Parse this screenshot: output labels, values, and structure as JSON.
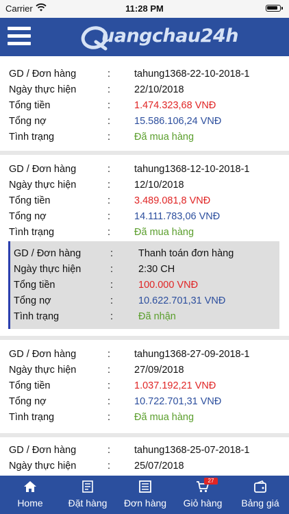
{
  "status_bar": {
    "carrier": "Carrier",
    "time": "11:28 PM"
  },
  "header": {
    "logo_text": "uangchau24h",
    "logo_full": "Quangchau24h"
  },
  "labels": {
    "order": "GD / Đơn hàng",
    "date": "Ngày thực hiện",
    "total": "Tổng tiền",
    "debt": "Tổng nợ",
    "status": "Tình trạng",
    "colon": ":"
  },
  "orders": [
    {
      "order": "tahung1368-22-10-2018-1",
      "date": "22/10/2018",
      "total": "1.474.323,68 VNĐ",
      "debt": "15.586.106,24 VNĐ",
      "status": "Đã mua hàng"
    },
    {
      "order": "tahung1368-12-10-2018-1",
      "date": "12/10/2018",
      "total": "3.489.081,8 VNĐ",
      "debt": "14.111.783,06 VNĐ",
      "status": "Đã mua hàng",
      "payment": {
        "order": "Thanh toán đơn hàng",
        "date": "2:30 CH",
        "total": "100.000 VNĐ",
        "debt": "10.622.701,31 VNĐ",
        "status": "Đã nhận"
      }
    },
    {
      "order": "tahung1368-27-09-2018-1",
      "date": "27/09/2018",
      "total": "1.037.192,21 VNĐ",
      "debt": "10.722.701,31 VNĐ",
      "status": "Đã mua hàng"
    },
    {
      "order": "tahung1368-25-07-2018-1",
      "date": "25/07/2018"
    }
  ],
  "bottom_nav": [
    {
      "label": "Home",
      "icon": "home-icon"
    },
    {
      "label": "Đặt hàng",
      "icon": "order-form-icon"
    },
    {
      "label": "Đơn hàng",
      "icon": "order-list-icon"
    },
    {
      "label": "Giỏ hàng",
      "icon": "cart-icon",
      "badge": "27"
    },
    {
      "label": "Bảng giá",
      "icon": "price-list-icon"
    }
  ],
  "colors": {
    "header_bg": "#2b4f9e",
    "total_red": "#e02525",
    "debt_blue": "#2d4f9e",
    "status_green": "#5a9e2c",
    "payment_accent": "#2b3fae"
  }
}
